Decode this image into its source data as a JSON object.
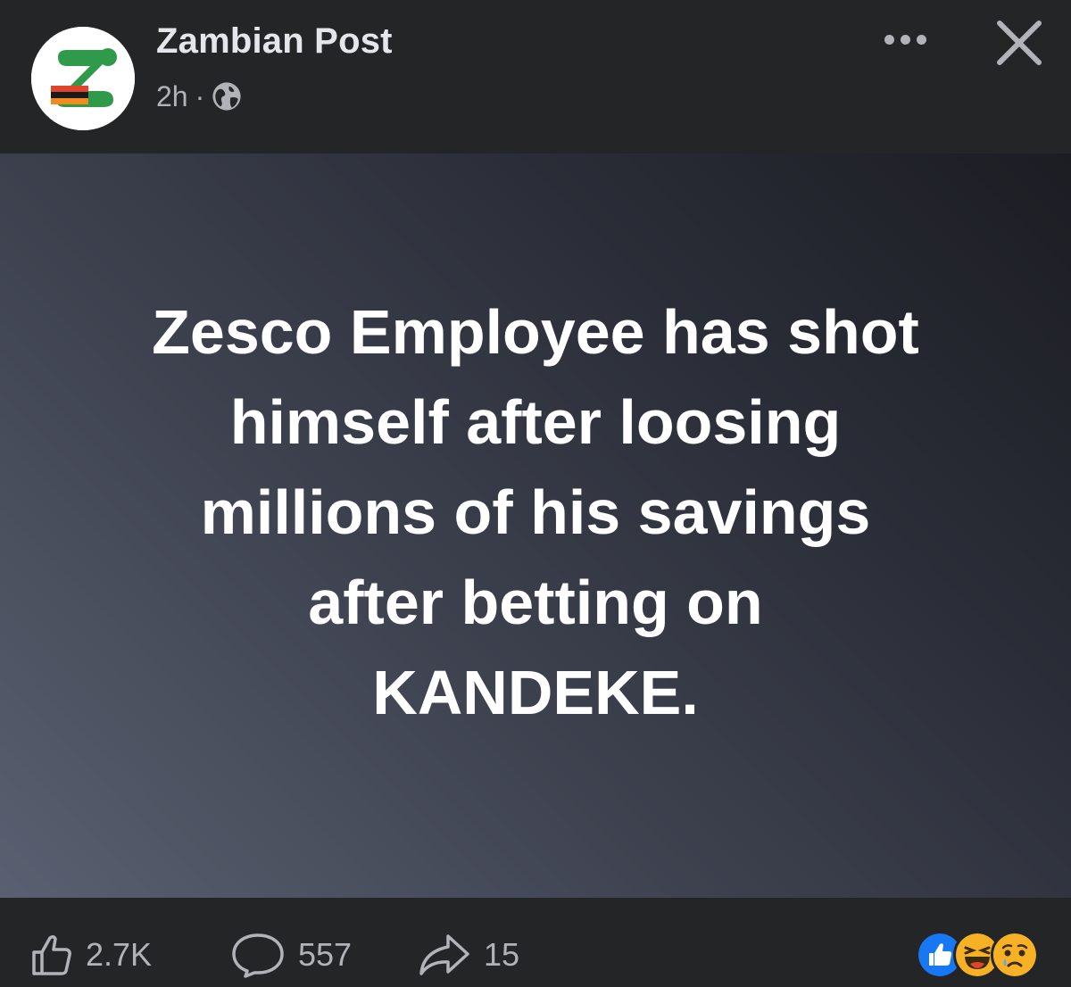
{
  "post": {
    "page_name": "Zambian Post",
    "time": "2h",
    "separator": "·",
    "privacy_icon": "globe-icon",
    "text_lines": [
      "Zesco Employee has shot",
      "himself after loosing",
      "millions of his savings",
      "after betting on",
      "KANDEKE."
    ]
  },
  "header": {
    "more_icon": "more-options-icon",
    "close_icon": "close-icon"
  },
  "footer": {
    "likes": "2.7K",
    "comments": "557",
    "shares": "15",
    "reactions": [
      "like-reaction-icon",
      "haha-reaction-icon",
      "sad-reaction-icon"
    ]
  },
  "colors": {
    "background": "#242526",
    "text_primary": "#e4e6eb",
    "text_secondary": "#b0b3b8",
    "like_blue": "#1877f2",
    "reaction_yellow": "#f7b125",
    "logo_green": "#2e9a4a",
    "logo_red": "#e0452b"
  }
}
